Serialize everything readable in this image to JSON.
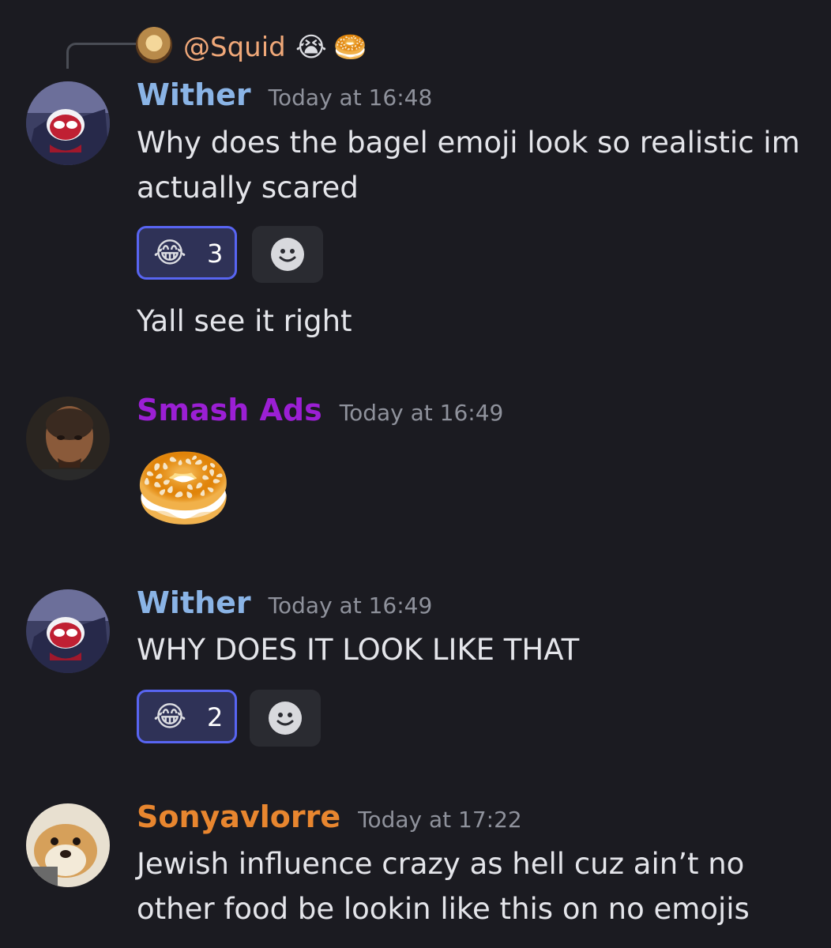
{
  "reply": {
    "username": "@Squid",
    "emojis": [
      "😭",
      "🥯"
    ]
  },
  "messages": [
    {
      "username": "Wither",
      "username_color": "#8ab4e6",
      "timestamp": "Today at 16:48",
      "lines": [
        "Why does the bagel emoji look so realistic im",
        "actually scared"
      ],
      "reaction": {
        "emoji": "😂",
        "count": "3"
      },
      "followup": "Yall see it right"
    },
    {
      "username": "Smash Ads",
      "username_color": "#9b1fd4",
      "timestamp": "Today at 16:49",
      "emoji_only": "🥯"
    },
    {
      "username": "Wither",
      "username_color": "#8ab4e6",
      "timestamp": "Today at 16:49",
      "lines": [
        "WHY DOES IT LOOK LIKE THAT"
      ],
      "reaction": {
        "emoji": "😂",
        "count": "2"
      }
    },
    {
      "username": "Sonyavlorre",
      "username_color": "#e8862f",
      "timestamp": "Today at 17:22",
      "lines": [
        "Jewish influence crazy as hell cuz ain’t no",
        "other food be lookin like this on no emojis"
      ]
    }
  ]
}
